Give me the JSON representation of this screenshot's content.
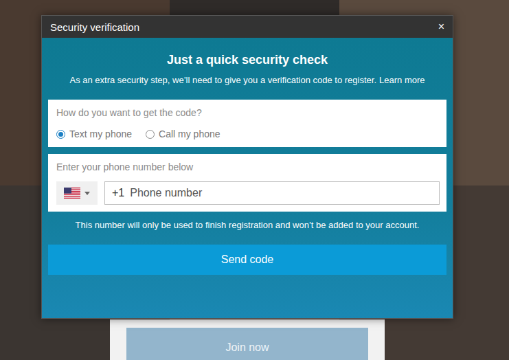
{
  "window": {
    "title": "Security verification",
    "close": "×"
  },
  "heading": "Just a quick security check",
  "subtitle": "As an extra security step, we’ll need to give you a verification code to register.",
  "learn_more": "Learn more",
  "code_method": {
    "prompt": "How do you want to get the code?",
    "options": [
      {
        "label": "Text my phone",
        "selected": true
      },
      {
        "label": "Call my phone",
        "selected": false
      }
    ]
  },
  "phone": {
    "prompt": "Enter your phone number below",
    "dial_code": "+1",
    "placeholder": "Phone number"
  },
  "note": "This number will only be used to finish registration and won’t be added to your account.",
  "send_button": "Send code",
  "background": {
    "join_button": "Join now"
  }
}
